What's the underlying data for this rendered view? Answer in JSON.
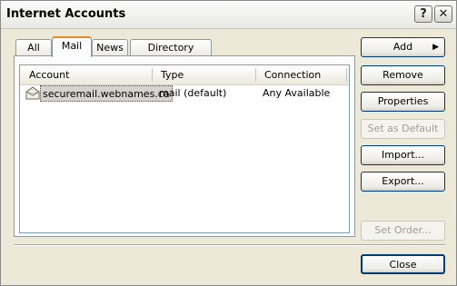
{
  "window": {
    "title": "Internet Accounts"
  },
  "titlebar_buttons": {
    "help": "?",
    "close": "✕"
  },
  "tabs": [
    {
      "label": "All",
      "active": false
    },
    {
      "label": "Mail",
      "active": true
    },
    {
      "label": "News",
      "active": false
    },
    {
      "label": "Directory Service",
      "active": false
    }
  ],
  "list": {
    "columns": [
      "Account",
      "Type",
      "Connection"
    ],
    "rows": [
      {
        "account": "securemail.webnames.ca",
        "type": "mail (default)",
        "connection": "Any Available",
        "icon": "mail-account-icon",
        "selected": true
      }
    ]
  },
  "buttons": {
    "add": {
      "label": "Add",
      "arrow": "▶"
    },
    "remove": "Remove",
    "properties": "Properties",
    "set_default": "Set as Default",
    "import": "Import...",
    "export": "Export...",
    "set_order": "Set Order...",
    "close": "Close"
  }
}
